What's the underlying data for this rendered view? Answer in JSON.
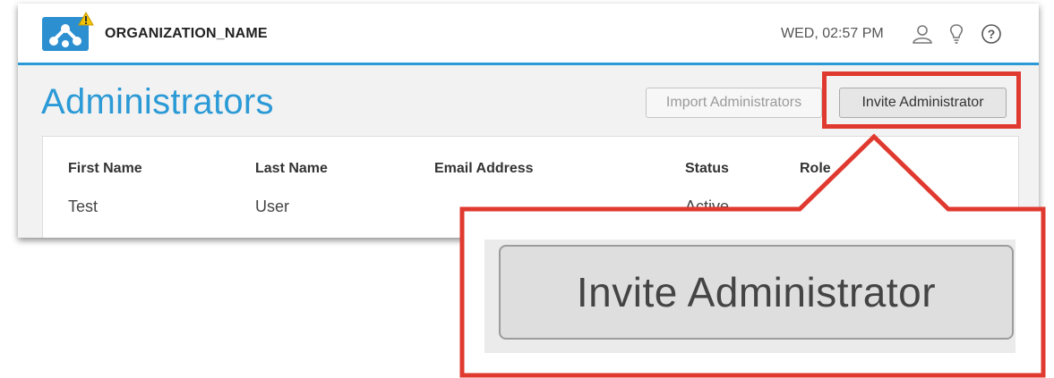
{
  "header": {
    "org_name": "ORGANIZATION_NAME",
    "datetime": "WED, 02:57 PM",
    "icons": [
      "logo-network-icon",
      "warning-icon",
      "user-icon",
      "lightbulb-icon",
      "help-icon"
    ]
  },
  "page": {
    "title": "Administrators",
    "import_label": "Import Administrators",
    "invite_label": "Invite Administrator"
  },
  "table": {
    "columns": [
      "First Name",
      "Last Name",
      "Email Address",
      "Status",
      "Role"
    ],
    "rows": [
      {
        "first_name": "Test",
        "last_name": "User",
        "email": "",
        "status": "Active",
        "role": ""
      }
    ]
  },
  "callout": {
    "zoomed_label": "Invite Administrator"
  },
  "colors": {
    "accent": "#2b9ad6",
    "highlight": "#e03a30",
    "warning": "#f5c400"
  }
}
